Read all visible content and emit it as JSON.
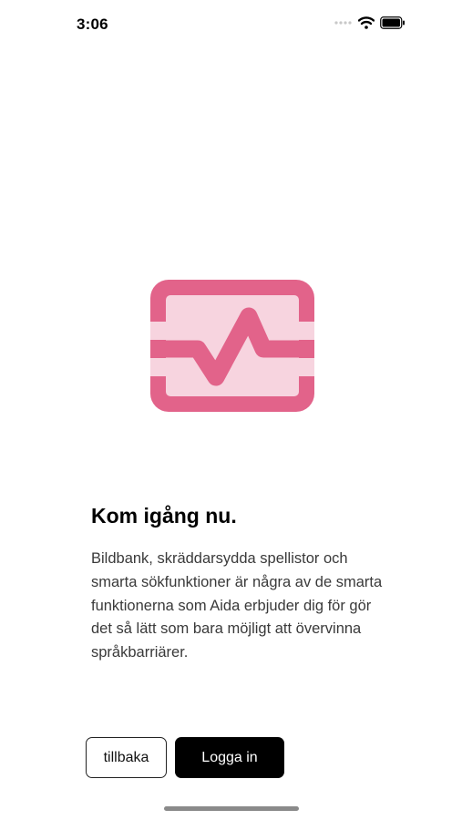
{
  "status_bar": {
    "time": "3:06"
  },
  "onboarding": {
    "icon": "pulse-monitor-icon",
    "title": "Kom igång nu.",
    "body": "Bildbank, skräddarsydda spellistor och smarta sökfunktioner är några av de smarta funktionerna som Aida erbjuder dig för gör det så lätt som bara möjligt att övervinna språkbarriärer."
  },
  "buttons": {
    "back_label": "tillbaka",
    "login_label": "Logga in"
  },
  "colors": {
    "accent": "#E2638A",
    "accent_light": "#F7D4DF",
    "primary_button": "#000000"
  }
}
